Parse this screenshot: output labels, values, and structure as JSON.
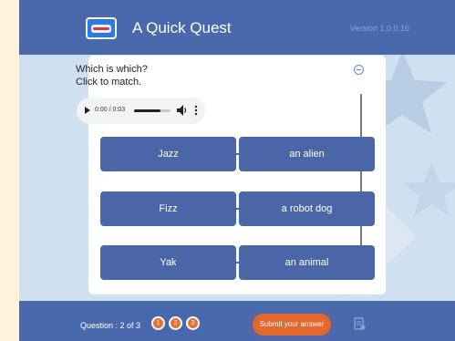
{
  "header": {
    "title": "A Quick Quest",
    "version": "Version 1.0.0.16",
    "logo_icon": "quest-logo-icon"
  },
  "question": {
    "prompt_line1": "Which is which?",
    "prompt_line2": "Click to match.",
    "collapse_icon": "minus-circle-icon"
  },
  "audio": {
    "time": "0:00 / 0:03",
    "progress": 0.72,
    "play_icon": "play-icon",
    "volume_icon": "volume-icon",
    "more_icon": "more-vertical-icon"
  },
  "matches": {
    "left": [
      "Jazz",
      "Fizz",
      "Yak"
    ],
    "right": [
      "an alien",
      "a robot dog",
      "an animal"
    ]
  },
  "footer": {
    "question_label": "Question : 2 of 3",
    "dots": [
      "1",
      "2",
      "3"
    ],
    "submit_label": "Submit your answer",
    "extra_icon": "notes-icon"
  },
  "colors": {
    "header_bg": "#4a69ad",
    "button_bg": "#4a66a6",
    "accent_orange": "#e2692e",
    "page_bg": "#cfe0f0"
  }
}
